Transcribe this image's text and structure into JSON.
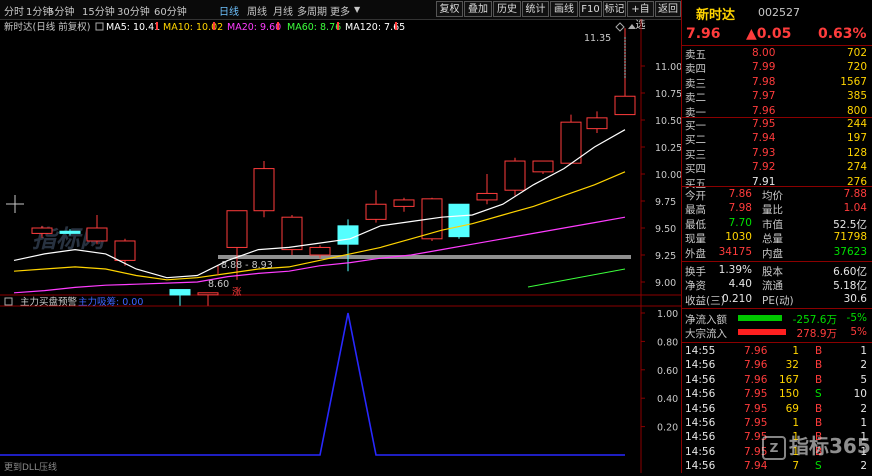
{
  "toolbar": {
    "timeframes": [
      "分时",
      "1分钟",
      "5分钟",
      "15分钟",
      "30分钟",
      "60分钟",
      "日线",
      "周线",
      "月线",
      "多周期",
      "更多"
    ],
    "active_timeframe": "日线",
    "buttons": [
      "复权",
      "叠加",
      "历史",
      "统计",
      "画线",
      "F10",
      "标记",
      "+自选",
      "返回"
    ]
  },
  "chart": {
    "stock_label": "新时达(日线 前复权)",
    "ma_labels": [
      {
        "text": "MA5: 10.41",
        "color": "#ffffff"
      },
      {
        "text": "MA10: 10.02",
        "color": "#ffd400"
      },
      {
        "text": "MA20: 9.60",
        "color": "#ff3cff"
      },
      {
        "text": "MA60: 8.76",
        "color": "#3cff3c"
      },
      {
        "text": "MA120: 7.65",
        "color": "#ffffff"
      }
    ],
    "price_ticks": [
      "11.00",
      "10.75",
      "10.50",
      "10.25",
      "10.00",
      "9.75",
      "9.50",
      "9.25",
      "9.00"
    ],
    "annotations": {
      "high": "11.35",
      "range": "8.88 - 8.93",
      "low": "8.60",
      "mark": "涨"
    },
    "indicator_title": "主力买盘预警",
    "indicator_value_label": "主力吸筹: 0.00",
    "indicator_ticks": [
      "1.00",
      "0.80",
      "0.60",
      "0.40",
      "0.20"
    ],
    "indicator_footer": "更到DLL压线"
  },
  "chart_data": {
    "type": "candlestick",
    "candles": [
      {
        "o": 9.45,
        "c": 9.5,
        "h": 9.52,
        "l": 9.41
      },
      {
        "o": 9.47,
        "c": 9.45,
        "h": 9.49,
        "l": 9.43
      },
      {
        "o": 9.38,
        "c": 9.5,
        "h": 9.62,
        "l": 9.35
      },
      {
        "o": 9.2,
        "c": 9.38,
        "h": 9.4,
        "l": 9.15
      },
      {
        "o": 8.93,
        "c": 8.88,
        "h": 8.93,
        "l": 8.78
      },
      {
        "o": 8.9,
        "c": 8.9,
        "h": 8.9,
        "l": 8.78
      },
      {
        "o": 9.32,
        "c": 9.66,
        "h": 9.66,
        "l": 9.02
      },
      {
        "o": 9.66,
        "c": 10.05,
        "h": 10.12,
        "l": 9.6
      },
      {
        "o": 9.3,
        "c": 9.6,
        "h": 9.62,
        "l": 9.25
      },
      {
        "o": 9.25,
        "c": 9.32,
        "h": 9.34,
        "l": 9.22
      },
      {
        "o": 9.52,
        "c": 9.35,
        "h": 9.58,
        "l": 9.1
      },
      {
        "o": 9.58,
        "c": 9.72,
        "h": 9.85,
        "l": 9.55
      },
      {
        "o": 9.7,
        "c": 9.76,
        "h": 9.78,
        "l": 9.65
      },
      {
        "o": 9.4,
        "c": 9.77,
        "h": 9.78,
        "l": 9.38
      },
      {
        "o": 9.72,
        "c": 9.42,
        "h": 9.72,
        "l": 9.4
      },
      {
        "o": 9.76,
        "c": 9.82,
        "h": 10.0,
        "l": 9.72
      },
      {
        "o": 9.85,
        "c": 10.12,
        "h": 10.15,
        "l": 9.8
      },
      {
        "o": 10.02,
        "c": 10.12,
        "h": 10.12,
        "l": 10.0
      },
      {
        "o": 10.1,
        "c": 10.48,
        "h": 10.55,
        "l": 10.1
      },
      {
        "o": 10.42,
        "c": 10.52,
        "h": 10.58,
        "l": 10.38
      },
      {
        "o": 10.55,
        "c": 10.72,
        "h": 11.35,
        "l": 10.55
      }
    ],
    "ma": [
      {
        "name": "MA5",
        "color": "#ffffff",
        "values": [
          9.2,
          9.26,
          9.3,
          9.26,
          9.12,
          9.04,
          9.06,
          9.2,
          9.3,
          9.32,
          9.36,
          9.4,
          9.52,
          9.56,
          9.6,
          9.62,
          9.72,
          9.9,
          10.05,
          10.25,
          10.41
        ]
      },
      {
        "name": "MA10",
        "color": "#ffd400",
        "values": [
          9.1,
          9.12,
          9.14,
          9.12,
          9.06,
          9.02,
          9.04,
          9.08,
          9.12,
          9.14,
          9.2,
          9.26,
          9.32,
          9.4,
          9.48,
          9.54,
          9.62,
          9.7,
          9.8,
          9.9,
          10.02
        ]
      },
      {
        "name": "MA20",
        "color": "#ff3cff",
        "values": [
          8.9,
          8.92,
          8.95,
          8.97,
          8.98,
          8.99,
          9.0,
          9.05,
          9.08,
          9.1,
          9.15,
          9.18,
          9.22,
          9.25,
          9.3,
          9.35,
          9.4,
          9.45,
          9.5,
          9.55,
          9.6
        ]
      }
    ],
    "indicator": {
      "values": [
        0,
        0,
        0,
        0,
        0,
        0,
        0,
        0,
        0,
        0,
        0,
        0,
        0,
        1,
        0,
        0,
        0,
        0,
        0,
        0,
        0,
        0,
        0,
        0,
        0,
        0,
        0,
        0,
        0,
        0,
        0
      ],
      "range": [
        0,
        1
      ]
    }
  },
  "panel": {
    "name": "新时达",
    "code": "002527",
    "price": "7.96",
    "change": "▲0.05",
    "pct": "0.63%",
    "asks": [
      {
        "label": "卖五",
        "price": "8.00",
        "vol": "702"
      },
      {
        "label": "卖四",
        "price": "7.99",
        "vol": "720"
      },
      {
        "label": "卖三",
        "price": "7.98",
        "vol": "1567"
      },
      {
        "label": "卖二",
        "price": "7.97",
        "vol": "385"
      },
      {
        "label": "卖一",
        "price": "7.96",
        "vol": "800"
      }
    ],
    "bids": [
      {
        "label": "买一",
        "price": "7.95",
        "vol": "244"
      },
      {
        "label": "买二",
        "price": "7.94",
        "vol": "197"
      },
      {
        "label": "买三",
        "price": "7.93",
        "vol": "128"
      },
      {
        "label": "买四",
        "price": "7.92",
        "vol": "274"
      },
      {
        "label": "买五",
        "price": "7.91",
        "vol": "276"
      }
    ],
    "stats": [
      {
        "l1": "今开",
        "v1": "7.86",
        "c1": "red",
        "l2": "均价",
        "v2": "7.88",
        "c2": "red"
      },
      {
        "l1": "最高",
        "v1": "7.98",
        "c1": "red",
        "l2": "量比",
        "v2": "1.04",
        "c2": "red"
      },
      {
        "l1": "最低",
        "v1": "7.70",
        "c1": "green",
        "l2": "市值",
        "v2": "52.5亿",
        "c2": "white"
      },
      {
        "l1": "现量",
        "v1": "1030",
        "c1": "yellow",
        "l2": "总量",
        "v2": "71798",
        "c2": "yellow"
      },
      {
        "l1": "外盘",
        "v1": "34175",
        "c1": "red",
        "l2": "内盘",
        "v2": "37623",
        "c2": "green"
      }
    ],
    "stats2": [
      {
        "l1": "换手",
        "v1": "1.39%",
        "l2": "股本",
        "v2": "6.60亿"
      },
      {
        "l1": "净资",
        "v1": "4.40",
        "l2": "流通",
        "v2": "5.18亿"
      },
      {
        "l1": "收益(三)",
        "v1": "0.210",
        "l2": "PE(动)",
        "v2": "30.6"
      }
    ],
    "flows": [
      {
        "label": "净流入额",
        "value": "-257.6万",
        "pct": "-5%",
        "color": "#00c800",
        "vcolor": "green",
        "bar": 0.55
      },
      {
        "label": "大宗流入",
        "value": "278.9万",
        "pct": "5%",
        "color": "#ff2020",
        "vcolor": "red",
        "bar": 0.6
      }
    ],
    "ticks": [
      {
        "t": "14:55",
        "p": "7.96",
        "v": "1",
        "s": "B",
        "n": "1"
      },
      {
        "t": "14:56",
        "p": "7.96",
        "v": "32",
        "s": "B",
        "n": "2"
      },
      {
        "t": "14:56",
        "p": "7.96",
        "v": "167",
        "s": "B",
        "n": "5"
      },
      {
        "t": "14:56",
        "p": "7.95",
        "v": "150",
        "s": "S",
        "n": "10"
      },
      {
        "t": "14:56",
        "p": "7.95",
        "v": "69",
        "s": "B",
        "n": "2"
      },
      {
        "t": "14:56",
        "p": "7.95",
        "v": "1",
        "s": "B",
        "n": "1"
      },
      {
        "t": "14:56",
        "p": "7.95",
        "v": "1",
        "s": "B",
        "n": "1"
      },
      {
        "t": "14:56",
        "p": "7.95",
        "v": "1",
        "s": "B",
        "n": "1"
      },
      {
        "t": "14:56",
        "p": "7.94",
        "v": "7",
        "s": "S",
        "n": "2"
      }
    ],
    "watermark": "指标365"
  },
  "watermark_chart": "指标网"
}
